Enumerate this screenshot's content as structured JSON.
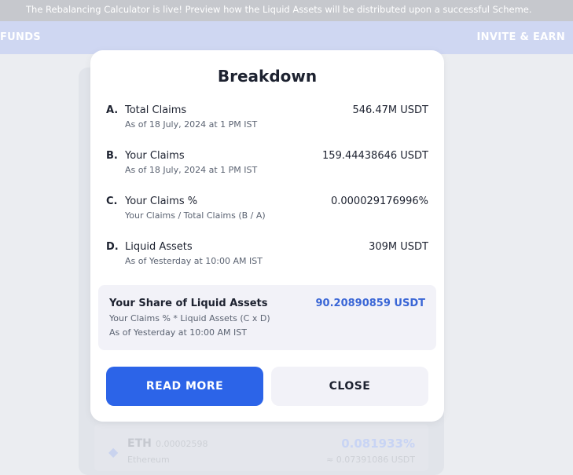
{
  "banner": {
    "text": "The Rebalancing Calculator is live! Preview how the Liquid Assets will be distributed upon a successful Scheme."
  },
  "nav": {
    "left_label": "FUNDS",
    "right_label": "INVITE & EARN"
  },
  "background_asset": {
    "symbol": "ETH",
    "amount": "0.00002598",
    "name": "Ethereum",
    "percent": "0.081933%",
    "usd_value": "≈ 0.07391086 USDT",
    "icon": "ethereum-icon"
  },
  "modal": {
    "title": "Breakdown",
    "rows": [
      {
        "letter": "A.",
        "label": "Total Claims",
        "sub": "As of 18 July, 2024 at 1 PM IST",
        "value": "546.47M USDT"
      },
      {
        "letter": "B.",
        "label": "Your Claims",
        "sub": "As of 18 July, 2024 at 1 PM IST",
        "value": "159.44438646 USDT"
      },
      {
        "letter": "C.",
        "label": "Your Claims %",
        "sub": "Your Claims / Total Claims (B / A)",
        "value": "0.000029176996%"
      },
      {
        "letter": "D.",
        "label": "Liquid Assets",
        "sub": "As of Yesterday at 10:00 AM IST",
        "value": "309M USDT"
      }
    ],
    "share": {
      "label": "Your Share of Liquid Assets",
      "formula": "Your Claims % * Liquid Assets (C x D)",
      "as_of": "As of Yesterday at 10:00 AM IST",
      "value": "90.20890859 USDT"
    },
    "read_more_label": "READ MORE",
    "close_label": "CLOSE"
  },
  "colors": {
    "accent": "#2c64e8",
    "share_value": "#3a66d6",
    "navbar": "#cfd7f2",
    "banner": "#c6c8cd"
  }
}
